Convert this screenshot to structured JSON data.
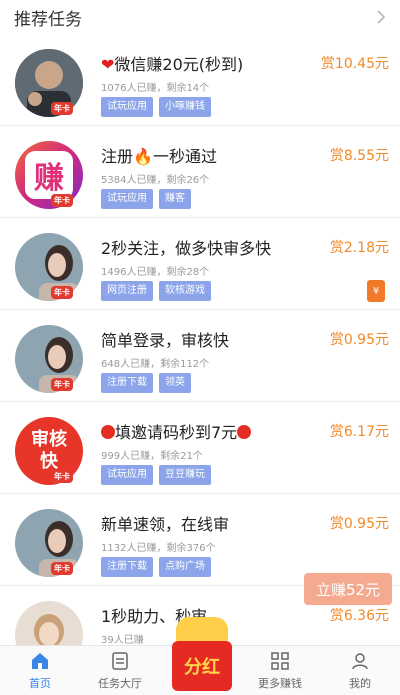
{
  "header": {
    "title": "推荐任务"
  },
  "tasks": [
    {
      "title_pre": "",
      "title": "微信赚20元(秒到)",
      "meta": "1076人已赚，剩余14个",
      "tags": [
        "试玩应用",
        "小啄赚钱"
      ],
      "reward": "赏10.45元",
      "badge": "年卡",
      "avatar_color": "#4a5560"
    },
    {
      "title_pre": "注册",
      "title": "一秒通过",
      "meta": "5384人已赚，剩余26个",
      "tags": [
        "试玩应用",
        "赚客"
      ],
      "reward": "赏8.55元",
      "badge": "年卡",
      "avatar_text": "赚",
      "avatar_color": "#e83870"
    },
    {
      "title_pre": "",
      "title": "2秒关注，做多快审多快",
      "meta": "1496人已赚，剩余28个",
      "tags": [
        "网页注册",
        "软核游戏"
      ],
      "reward": "赏2.18元",
      "badge": "年卡",
      "avatar_color": "#7a8f9c"
    },
    {
      "title_pre": "",
      "title": "简单登录，审核快",
      "meta": "648人已赚，剩余112个",
      "tags": [
        "注册下载",
        "领英"
      ],
      "reward": "赏0.95元",
      "badge": "年卡",
      "avatar_color": "#7a8f9c"
    },
    {
      "title_pre": "",
      "title": "填邀请码秒到7元",
      "meta": "999人已赚，剩余21个",
      "tags": [
        "试玩应用",
        "豆豆赚玩"
      ],
      "reward": "赏6.17元",
      "badge": "年卡",
      "avatar_text": "审核快",
      "avatar_color": "#e8352a"
    },
    {
      "title_pre": "",
      "title": "新单速领，在线审",
      "meta": "1132人已赚，剩余376个",
      "tags": [
        "注册下载",
        "点购广场"
      ],
      "reward": "赏0.95元",
      "badge": "年卡",
      "avatar_color": "#7a8f9c"
    },
    {
      "title_pre": "",
      "title": "1秒助力、秒审",
      "meta": "39人已赚",
      "tags": [],
      "reward": "赏6.36元",
      "badge": "",
      "avatar_color": "#d8c8b8"
    }
  ],
  "floating": {
    "earn_label": "立赚52元",
    "side_icon": "¥"
  },
  "promo": {
    "label": "分红"
  },
  "tabbar": [
    {
      "label": "首页",
      "icon": "home-icon",
      "active": true
    },
    {
      "label": "任务大厅",
      "icon": "task-hall-icon",
      "active": false
    },
    {
      "label": "",
      "icon": "promo",
      "active": false
    },
    {
      "label": "更多赚钱",
      "icon": "grid-icon",
      "active": false
    },
    {
      "label": "我的",
      "icon": "user-icon",
      "active": false
    }
  ],
  "colors": {
    "reward": "#f08a2a",
    "tag": "#8ba4ea",
    "active_tab": "#3a86e6",
    "promo_red": "#e52a23"
  }
}
